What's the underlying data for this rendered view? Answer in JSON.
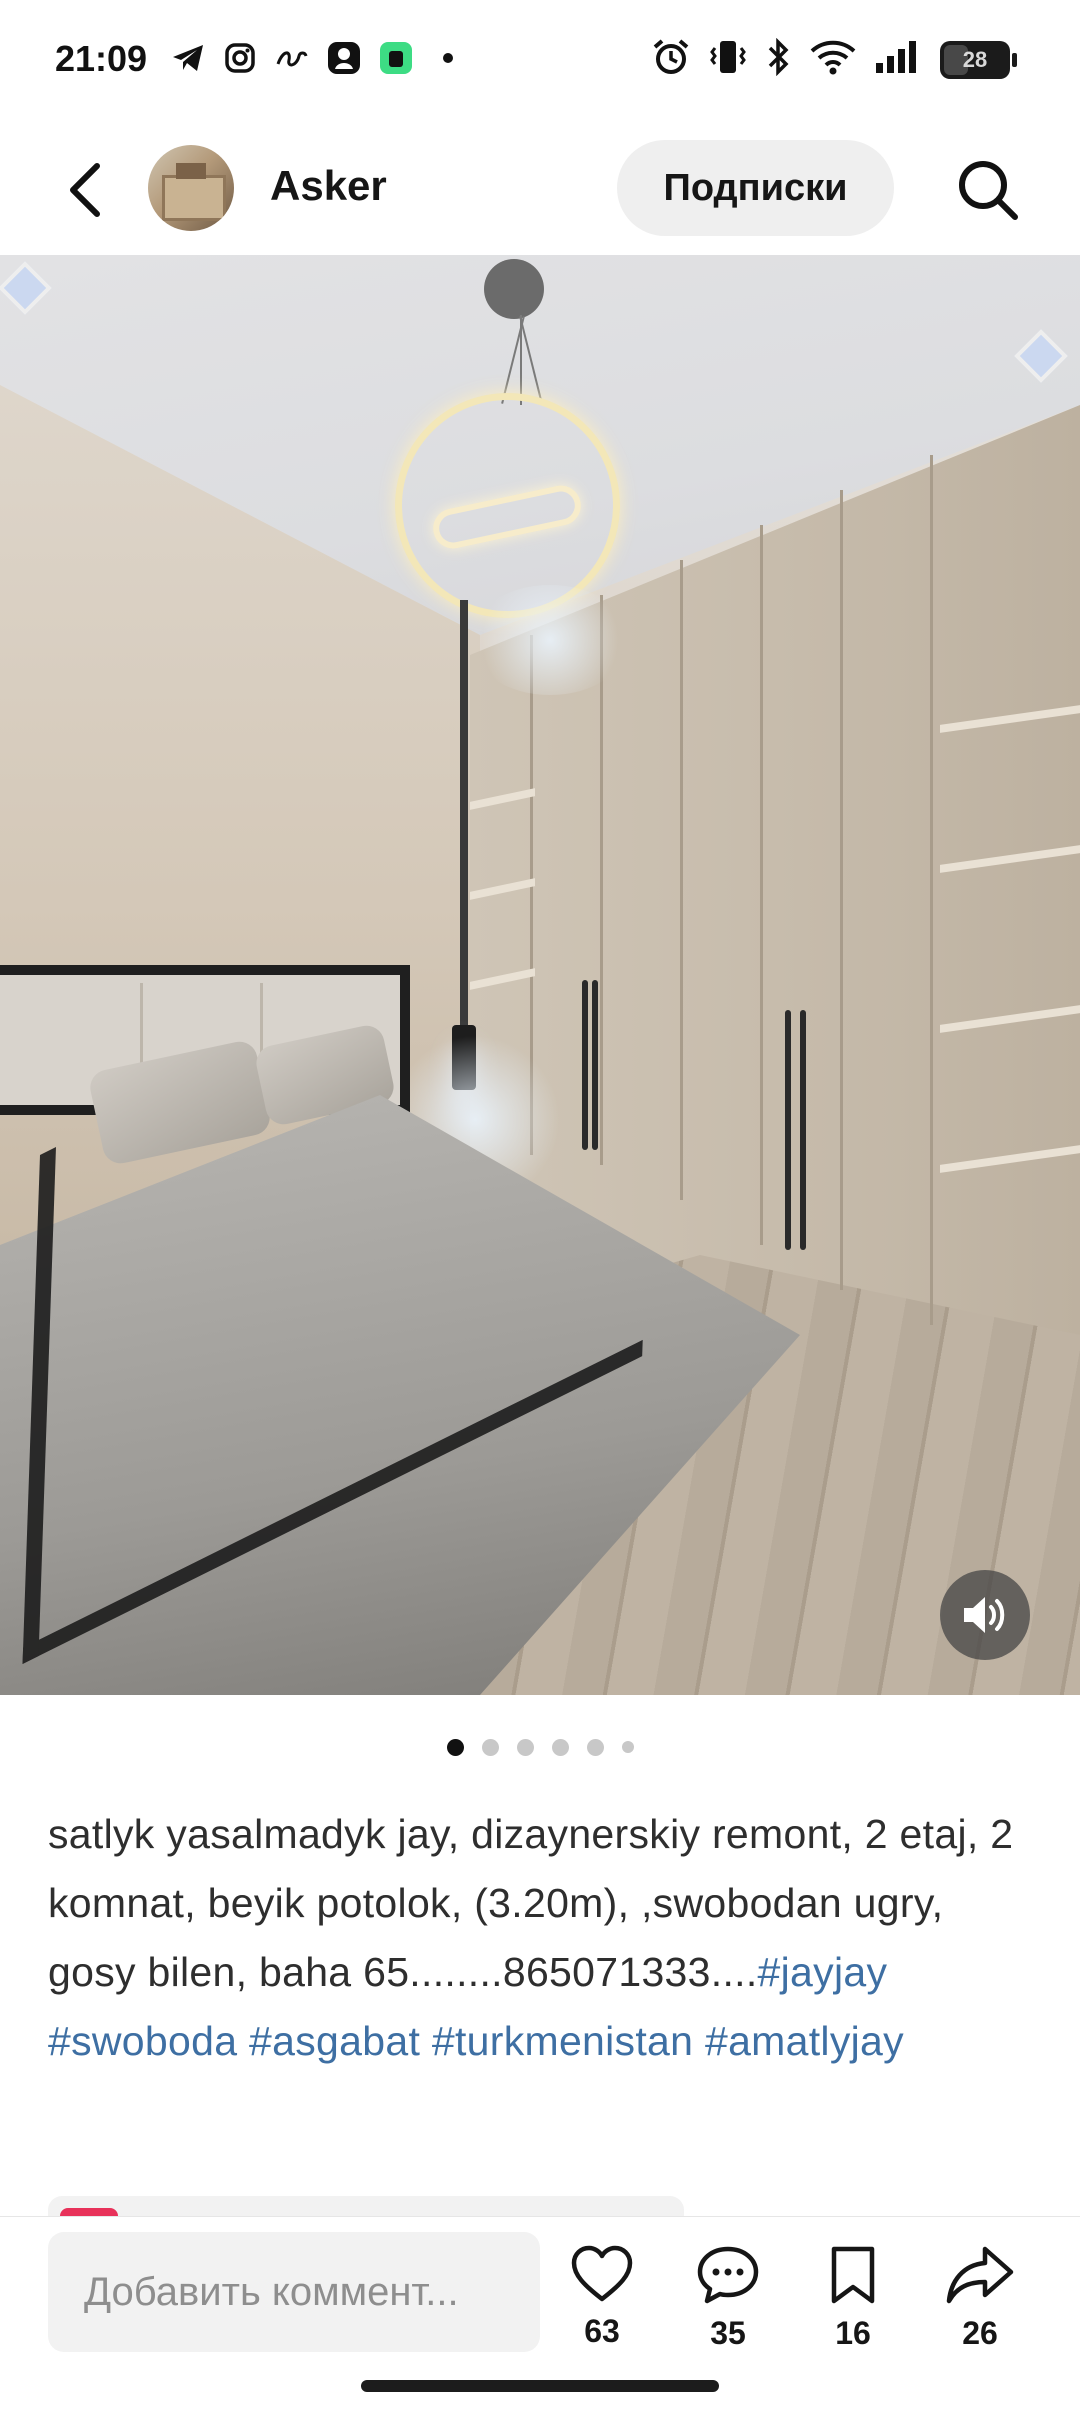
{
  "status_bar": {
    "time": "21:09",
    "left_icons": [
      "telegram-icon",
      "instagram-icon",
      "swirl-icon",
      "app-icon",
      "android-icon",
      "dot-icon"
    ],
    "right_icons": [
      "alarm-icon",
      "vibrate-icon",
      "bluetooth-icon",
      "wifi-icon",
      "signal-icon"
    ],
    "battery": "28"
  },
  "header": {
    "username": "Asker",
    "subscribe_label": "Подписки"
  },
  "carousel": {
    "total": 6,
    "active_index": 0
  },
  "caption": {
    "text": "satlyk yasalmadyk jay, dizaynerskiy remont, 2 etaj, 2 komnat, beyik potolok, (3.20m), ,swobodan ugry, gosy bilen, baha 65........865071333....",
    "hashtags": [
      "#jayjay",
      "#swoboda",
      "#asgabat",
      "#turkmenistan",
      "#amatlyjay"
    ]
  },
  "bottom_bar": {
    "comment_placeholder": "Добавить коммент...",
    "likes": "63",
    "comments": "35",
    "saves": "16",
    "shares": "26"
  },
  "colors": {
    "hashtag": "#3e6fa3",
    "accent": "#e8325a"
  }
}
